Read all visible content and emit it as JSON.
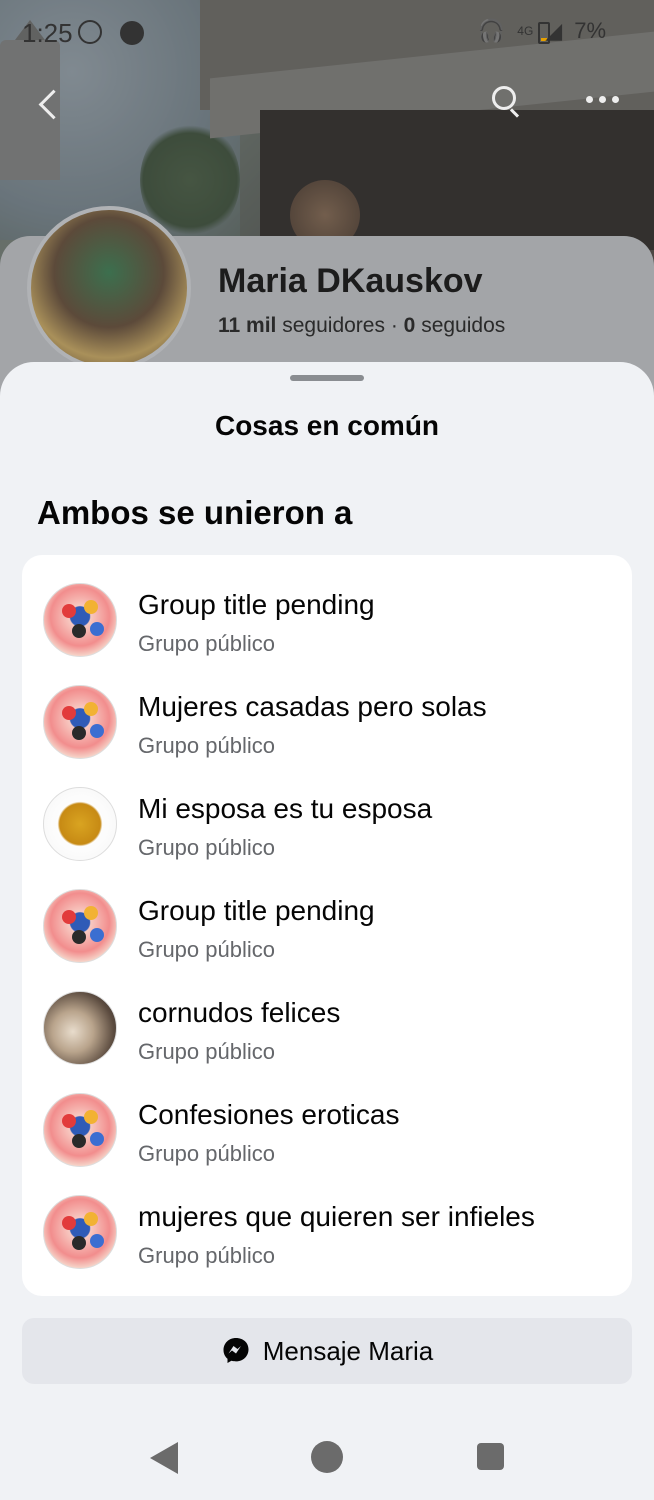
{
  "status_bar": {
    "time": "1:25",
    "network": "4G",
    "battery": "7%"
  },
  "profile": {
    "name": "Maria DKauskov",
    "followers_count": "11 mil",
    "followers_label": "seguidores",
    "separator": "·",
    "following_count": "0",
    "following_label": "seguidos"
  },
  "sheet": {
    "title": "Cosas en común",
    "section_title": "Ambos se unieron a",
    "groups": [
      {
        "name": "Group title pending",
        "type": "Grupo público",
        "avatar": "art"
      },
      {
        "name": "Mujeres casadas pero solas",
        "type": "Grupo público",
        "avatar": "art"
      },
      {
        "name": "Mi esposa es tu esposa",
        "type": "Grupo público",
        "avatar": "emoji"
      },
      {
        "name": "Group title pending",
        "type": "Grupo público",
        "avatar": "art"
      },
      {
        "name": "cornudos felices",
        "type": "Grupo público",
        "avatar": "photo"
      },
      {
        "name": "Confesiones eroticas",
        "type": "Grupo público",
        "avatar": "art"
      },
      {
        "name": "mujeres que quieren ser infieles",
        "type": "Grupo público",
        "avatar": "art"
      }
    ],
    "message_button_label": "Mensaje Maria"
  },
  "colors": {
    "sheet_bg": "#f0f2f5",
    "card_bg": "#ffffff",
    "secondary_text": "#65676b",
    "button_bg": "#e4e6eb"
  },
  "icons": {
    "messenger": "messenger-icon",
    "back": "chevron-left-icon",
    "search": "search-icon",
    "more": "more-horizontal-icon"
  }
}
